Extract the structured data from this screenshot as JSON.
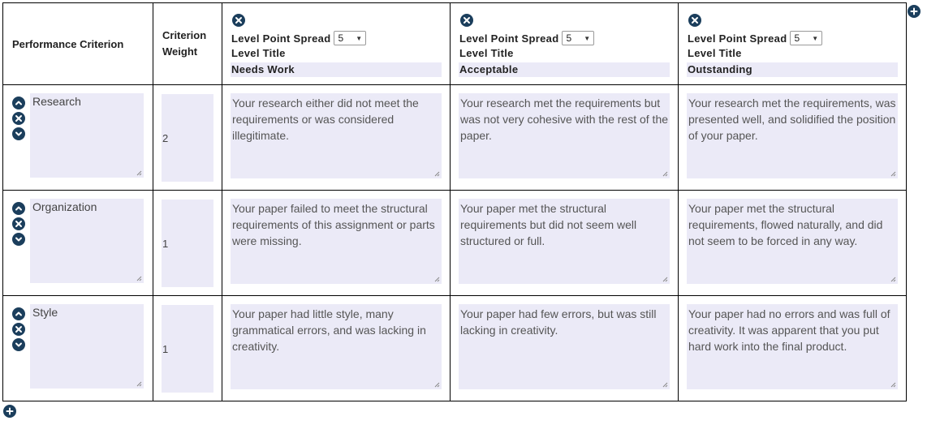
{
  "header": {
    "criterion_label": "Performance Criterion",
    "weight_label_line1": "Criterion",
    "weight_label_line2": "Weight",
    "spread_label": "Level Point Spread",
    "title_label": "Level Title"
  },
  "levels": [
    {
      "spread": "5",
      "title": "Needs Work"
    },
    {
      "spread": "5",
      "title": "Acceptable"
    },
    {
      "spread": "5",
      "title": "Outstanding"
    }
  ],
  "rows": [
    {
      "criterion": "Research",
      "weight": "2",
      "descriptions": [
        "Your research either did not meet the requirements or was considered illegitimate.",
        "Your research met the requirements but was not very cohesive with the rest of the paper.",
        "Your research met the requirements, was presented well, and solidified the position of your paper."
      ]
    },
    {
      "criterion": "Organization",
      "weight": "1",
      "descriptions": [
        "Your paper failed to meet the structural requirements of this assignment or parts were missing.",
        "Your paper met the structural requirements but did not seem well structured or full.",
        "Your paper met the structural requirements, flowed naturally, and did not seem to be forced in any way."
      ]
    },
    {
      "criterion": "Style",
      "weight": "1",
      "descriptions": [
        "Your paper had little style, many grammatical errors, and was lacking in creativity.",
        "Your paper had few errors, but was still lacking in creativity.",
        "Your paper had no errors and was full of creativity. It was apparent that you put hard work into the final product."
      ]
    }
  ],
  "colors": {
    "icon": "#1b3e5c",
    "field_background": "#ebeaf7"
  },
  "icons": {
    "add": "plus-circle-icon",
    "remove": "x-circle-icon",
    "move_up": "chevron-up-circle-icon",
    "move_down": "chevron-down-circle-icon"
  }
}
